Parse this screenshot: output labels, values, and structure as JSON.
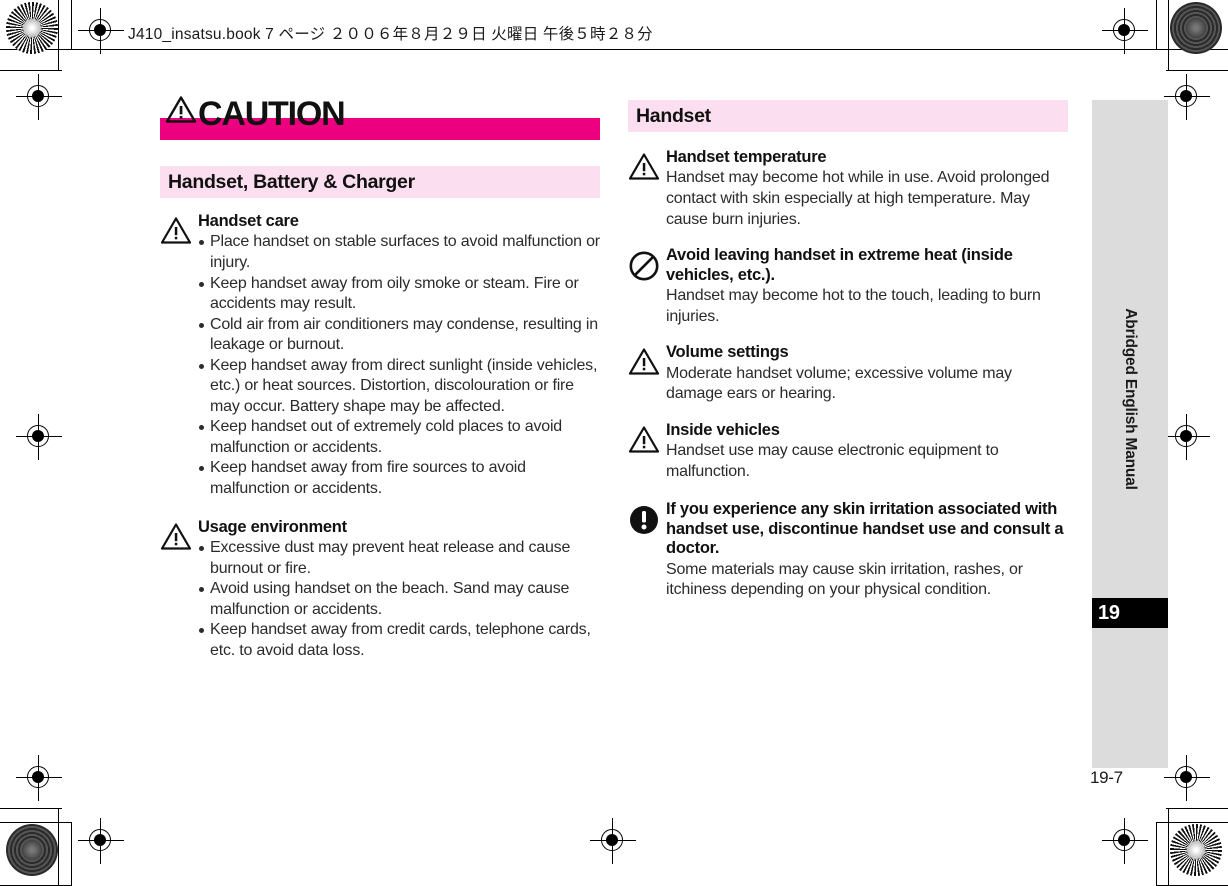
{
  "header": {
    "slug": "J410_insatsu.book  7 ページ  ２００６年８月２９日   火曜日   午後５時２８分"
  },
  "colors": {
    "magenta_bar": "#ec0080",
    "pink_band": "#fbdff0",
    "tab_gray": "#dcdcdc",
    "tab_number_bg": "#000000"
  },
  "left_column": {
    "caution_label": "CAUTION",
    "caution_icon": "warning-triangle-icon",
    "section_band": "Handset, Battery & Charger",
    "entries": [
      {
        "icon": "warning-triangle-icon",
        "title": "Handset care",
        "bullets": [
          "Place handset on stable surfaces to avoid malfunction or injury.",
          "Keep handset away from oily smoke or steam. Fire or accidents may result.",
          "Cold air from air conditioners may condense, resulting in leakage or burnout.",
          "Keep handset away from direct sunlight (inside vehicles, etc.) or heat sources. Distortion, discolouration or fire may occur. Battery shape may be affected.",
          "Keep handset out of extremely cold places to avoid malfunction or accidents.",
          "Keep handset away from fire sources to avoid malfunction or accidents."
        ]
      },
      {
        "icon": "warning-triangle-icon",
        "title": "Usage environment",
        "bullets": [
          "Excessive dust may prevent heat release and cause burnout or fire.",
          "Avoid using handset on the beach. Sand may cause malfunction or accidents.",
          "Keep handset away from credit cards, telephone cards, etc. to avoid data loss."
        ]
      }
    ]
  },
  "right_column": {
    "section_band": "Handset",
    "entries": [
      {
        "icon": "warning-triangle-icon",
        "title": "Handset temperature",
        "text": "Handset may become hot while in use. Avoid prolonged contact with skin especially at high temperature. May cause burn injuries."
      },
      {
        "icon": "prohibition-icon",
        "title": "Avoid leaving handset in extreme heat (inside vehicles, etc.).",
        "text": "Handset may become hot to the touch, leading to burn injuries."
      },
      {
        "icon": "warning-triangle-icon",
        "title": "Volume settings",
        "text": "Moderate handset volume; excessive volume may damage ears or hearing."
      },
      {
        "icon": "warning-triangle-icon",
        "title": "Inside vehicles",
        "text": "Handset use may cause electronic equipment to malfunction."
      },
      {
        "icon": "mandatory-exclamation-icon",
        "title": "If you experience any skin irritation associated with handset use, discontinue handset use and consult a doctor.",
        "text": "Some materials may cause skin irritation, rashes, or itchiness depending on your physical condition."
      }
    ]
  },
  "side_tab": {
    "label": "Abridged English Manual",
    "number": "19"
  },
  "folio": "19-7"
}
